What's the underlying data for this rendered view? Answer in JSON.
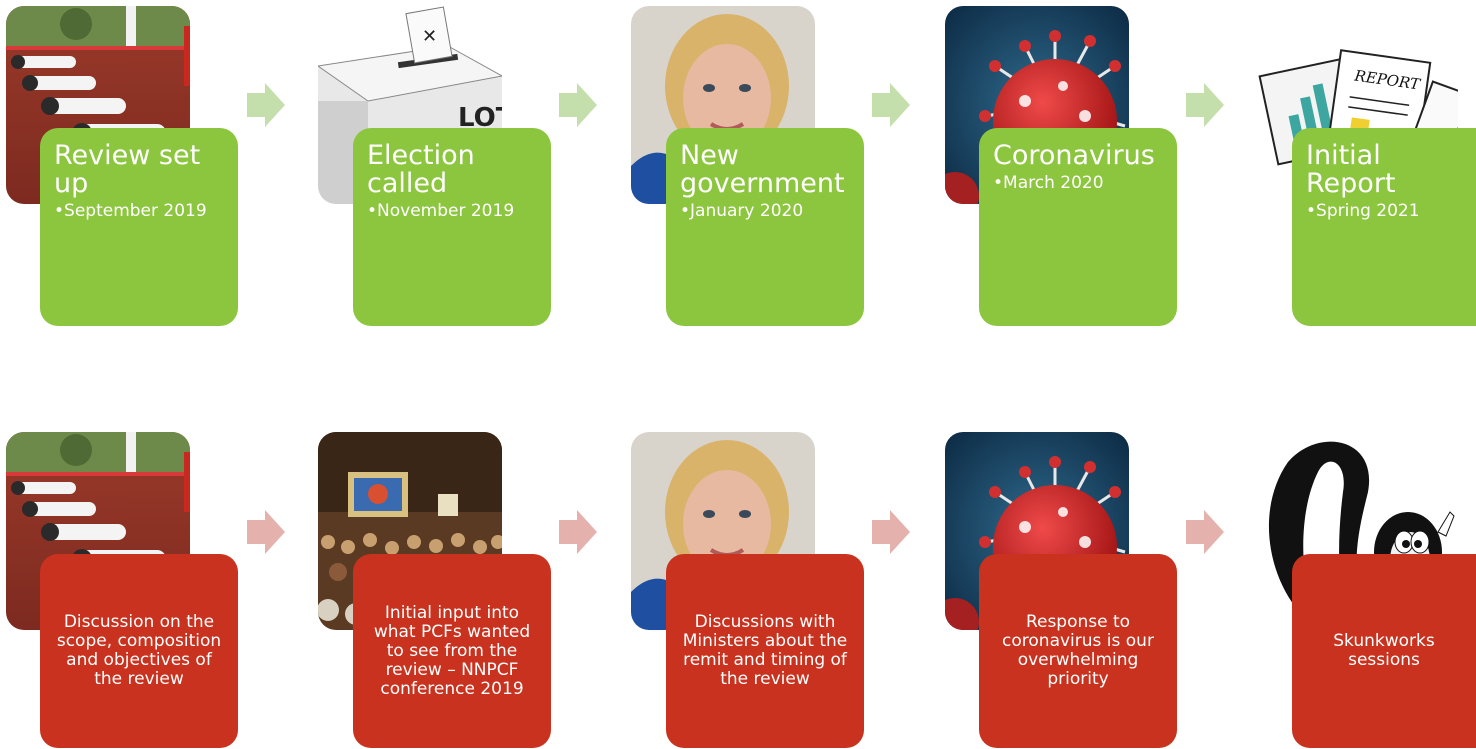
{
  "colors": {
    "green": "#8cc63f",
    "red": "#c8321f",
    "green_arrow": "#c5dfac",
    "red_arrow": "#e5b1ac"
  },
  "top_row": [
    {
      "title": "Review set up",
      "detail": "•September 2019",
      "image": "sprinters-start-line"
    },
    {
      "title": "Election called",
      "detail": "•November 2019",
      "image": "ballot-box"
    },
    {
      "title": "New government",
      "detail": "•January 2020",
      "image": "minister-portrait"
    },
    {
      "title": "Coronavirus",
      "detail": "•March 2020",
      "image": "virus-illustration"
    },
    {
      "title": "Initial Report",
      "detail": "•Spring 2021",
      "image": "report-papers"
    }
  ],
  "bottom_row": [
    {
      "text": "Discussion on the scope, composition and objectives of the review",
      "image": "sprinters-start-line"
    },
    {
      "text": "Initial input into what PCFs wanted to see from the review – NNPCF conference 2019",
      "image": "conference-hall"
    },
    {
      "text": "Discussions with Ministers about the remit and timing of the review",
      "image": "minister-portrait"
    },
    {
      "text": "Response to coronavirus is our overwhelming priority",
      "image": "virus-illustration"
    },
    {
      "text": "Skunkworks sessions",
      "image": "skunk-cartoon"
    }
  ]
}
